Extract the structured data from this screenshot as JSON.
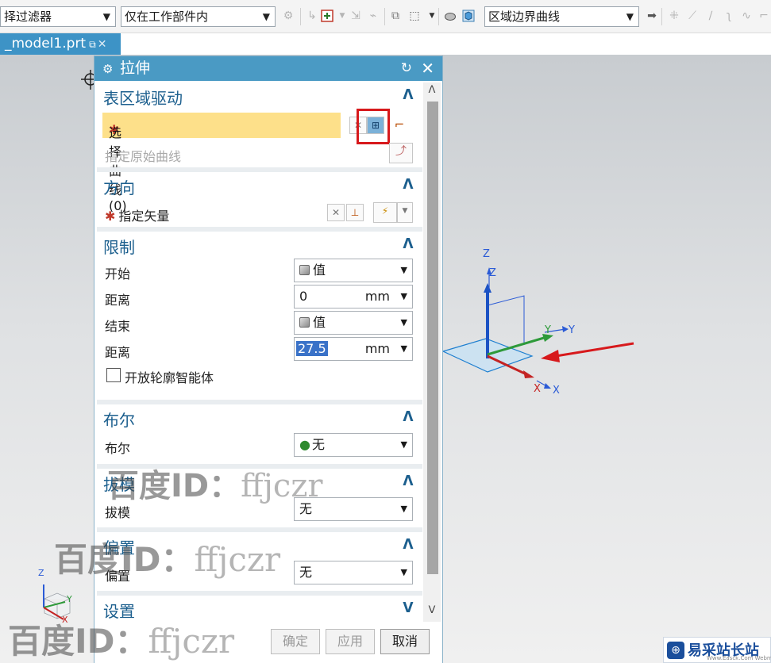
{
  "toolbar": {
    "filter_combo": "择过滤器",
    "scope_combo": "仅在工作部件内",
    "curve_rule_combo": "区域边界曲线"
  },
  "tab": {
    "title": "_model1.prt"
  },
  "dialog": {
    "title": "拉伸",
    "sections": {
      "region": {
        "header": "表区域驱动",
        "select_curve": "选择曲线 (0)",
        "specify_origin": "指定原始曲线"
      },
      "direction": {
        "header": "方向",
        "specify_vector": "指定矢量"
      },
      "limits": {
        "header": "限制",
        "start_label": "开始",
        "start_value": "值",
        "distance1_label": "距离",
        "distance1_value": "0",
        "distance1_unit": "mm",
        "end_label": "结束",
        "end_value": "值",
        "distance2_label": "距离",
        "distance2_value": "27.5",
        "distance2_unit": "mm",
        "open_profile": "开放轮廓智能体"
      },
      "boolean": {
        "header": "布尔",
        "label": "布尔",
        "value": "无"
      },
      "draft": {
        "header": "拔模",
        "label": "拔模",
        "value": "无"
      },
      "offset": {
        "header": "偏置",
        "label": "偏置",
        "value": "无"
      },
      "settings": {
        "header": "设置"
      }
    },
    "buttons": {
      "ok": "确定",
      "apply": "应用",
      "cancel": "取消"
    }
  },
  "axes": {
    "z1": "Z",
    "z2": "Z",
    "y1": "Y",
    "y2": "Y",
    "x1": "X",
    "x2": "X"
  },
  "mini_axes": {
    "z": "Z",
    "y": "Y",
    "x": "X"
  },
  "watermark": {
    "prefix": "百度ID：",
    "handle": "ffjczr"
  },
  "logo": {
    "name": "易采站长站",
    "sub": "Www.Easck.Com Webmaster"
  },
  "colors": {
    "title_bar": "#4a9ac4",
    "section_header": "#1c5f8e",
    "required_star": "#c0392b",
    "selection_highlight": "#fde08a",
    "annotation_red": "#d7191c"
  }
}
